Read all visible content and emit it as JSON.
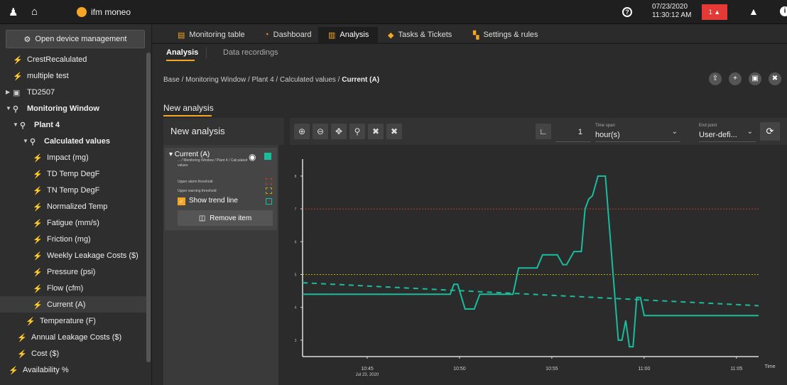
{
  "app": {
    "name": "ifm moneo"
  },
  "topbar": {
    "date": "07/23/2020",
    "time": "11:30:12 AM",
    "alarm_count": "1",
    "alarm_color": "#e53935"
  },
  "sidebar": {
    "open_device_label": "Open device management",
    "items": [
      {
        "label": "CrestRecalulated",
        "level": 1,
        "icon": "sensor-icon"
      },
      {
        "label": "multiple test",
        "level": 1,
        "icon": "sensor-icon"
      },
      {
        "label": "TD2507",
        "level": 0,
        "icon": "device-icon"
      },
      {
        "label": "Monitoring Window",
        "level": 0,
        "icon": "folder-icon",
        "bold": true
      },
      {
        "label": "Plant 4",
        "level": 1,
        "icon": "folder-icon",
        "bold": true
      },
      {
        "label": "Calculated values",
        "level": 2,
        "icon": "folder-icon",
        "bold": true
      },
      {
        "label": "Impact (mg)",
        "level": 3,
        "icon": "sensor-icon"
      },
      {
        "label": "TD Temp DegF",
        "level": 3,
        "icon": "sensor-icon"
      },
      {
        "label": "TN Temp DegF",
        "level": 3,
        "icon": "sensor-icon"
      },
      {
        "label": "Normalized Temp",
        "level": 3,
        "icon": "sensor-icon"
      },
      {
        "label": "Fatigue (mm/s)",
        "level": 3,
        "icon": "sensor-icon"
      },
      {
        "label": "Friction (mg)",
        "level": 3,
        "icon": "sensor-icon"
      },
      {
        "label": "Weekly Leakage Costs ($)",
        "level": 3,
        "icon": "sensor-icon"
      },
      {
        "label": "Pressure (psi)",
        "level": 3,
        "icon": "sensor-icon"
      },
      {
        "label": "Flow (cfm)",
        "level": 3,
        "icon": "sensor-icon"
      },
      {
        "label": "Current (A)",
        "level": 3,
        "icon": "sensor-icon",
        "selected": true
      },
      {
        "label": "Temperature (F)",
        "level": 2,
        "icon": "sensor-icon"
      },
      {
        "label": "Annual Leakage Costs ($)",
        "level": 1,
        "icon": "sensor-icon"
      },
      {
        "label": "Cost ($)",
        "level": 1,
        "icon": "sensor-icon"
      },
      {
        "label": "Availability %",
        "level": 1,
        "icon": "sensor-icon"
      }
    ]
  },
  "tabs": [
    {
      "label": "Monitoring table",
      "icon": "table-icon"
    },
    {
      "label": "Dashboard",
      "icon": "gauge-icon"
    },
    {
      "label": "Analysis",
      "icon": "analysis-icon",
      "active": true
    },
    {
      "label": "Tasks & Tickets",
      "icon": "tasks-icon"
    },
    {
      "label": "Settings & rules",
      "icon": "settings-icon"
    }
  ],
  "subtabs": [
    {
      "label": "Analysis",
      "active": true
    },
    {
      "label": "Data recordings"
    }
  ],
  "breadcrumb": {
    "path": "Base / Monitoring Window / Plant 4 / Calculated values / ",
    "last": "Current (A)"
  },
  "section_title": "New analysis",
  "analysis": {
    "title": "New analysis",
    "timespan_count": "1",
    "timespan_label": "Time span",
    "timespan_value": "hour(s)",
    "endpoint_label": "End point",
    "endpoint_value": "User-defi..."
  },
  "legend": {
    "series_name": "▾ Current (A)",
    "series_path": "... / Monitoring Window / Plant 4 / Calculated values",
    "upper_alarm_label": "Upper alarm threshold",
    "upper_warning_label": "Upper warning threshold",
    "trend_label": "Show trend line",
    "remove_label": "Remove item",
    "series_color": "#1abc9c",
    "alarm_color": "#c0392b",
    "warning_color": "#b8b000"
  },
  "chart_data": {
    "type": "line",
    "xlabel": "Time",
    "x_ticks": [
      "10:45",
      "10:50",
      "10:55",
      "11:00",
      "11:05"
    ],
    "x_tick_sublabel": "Jul 23, 2020",
    "xlim_minutes": [
      -3.5,
      21.2
    ],
    "ylim": [
      2.5,
      8.3
    ],
    "y_ticks": [
      "3",
      "4",
      "5",
      "6",
      "7",
      "8"
    ],
    "upper_alarm_threshold": 7.0,
    "upper_warning_threshold": 5.0,
    "series": [
      {
        "color": "#1abc9c",
        "points": [
          [
            -3.5,
            4.4
          ],
          [
            4.5,
            4.4
          ],
          [
            4.7,
            4.7
          ],
          [
            4.9,
            4.7
          ],
          [
            5.3,
            3.95
          ],
          [
            5.8,
            3.95
          ],
          [
            6.1,
            4.4
          ],
          [
            7.9,
            4.4
          ],
          [
            8.2,
            5.2
          ],
          [
            9.2,
            5.2
          ],
          [
            9.5,
            5.6
          ],
          [
            10.3,
            5.6
          ],
          [
            10.6,
            5.3
          ],
          [
            10.8,
            5.3
          ],
          [
            11.2,
            5.7
          ],
          [
            11.6,
            5.7
          ],
          [
            11.8,
            7.0
          ],
          [
            12.0,
            7.3
          ],
          [
            12.2,
            7.4
          ],
          [
            12.5,
            8.0
          ],
          [
            12.9,
            8.0
          ],
          [
            13.6,
            3.0
          ],
          [
            13.8,
            3.0
          ],
          [
            14.0,
            3.6
          ],
          [
            14.2,
            2.8
          ],
          [
            14.4,
            2.8
          ],
          [
            14.6,
            4.3
          ],
          [
            14.8,
            4.3
          ],
          [
            15.0,
            3.75
          ],
          [
            21.2,
            3.75
          ]
        ]
      }
    ],
    "trend_line": {
      "color": "#1abc9c",
      "start": [
        -3.5,
        4.75
      ],
      "end": [
        21.2,
        4.05
      ]
    }
  }
}
